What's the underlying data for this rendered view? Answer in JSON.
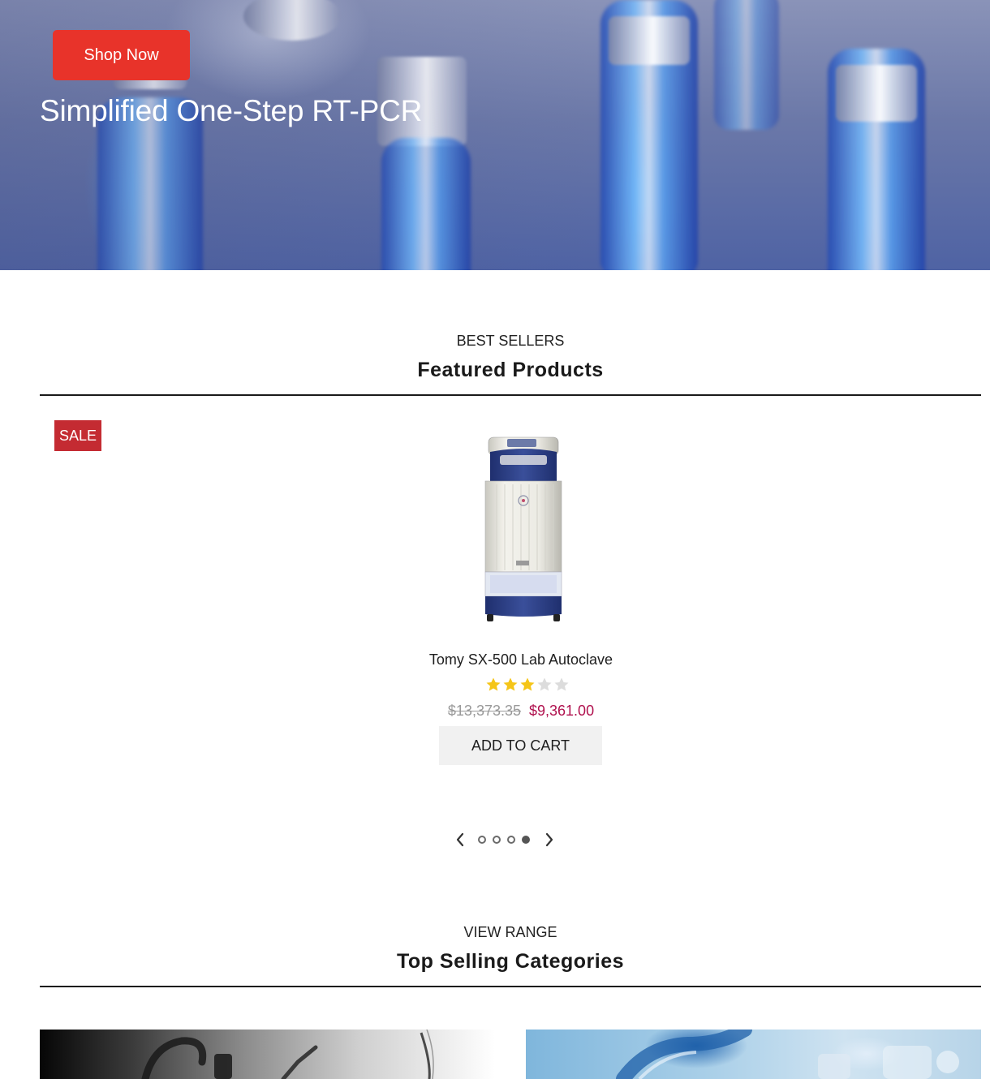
{
  "hero": {
    "button_label": "Shop Now",
    "title": "Simplified One-Step RT-PCR"
  },
  "featured": {
    "kicker": "BEST SELLERS",
    "title": "Featured Products",
    "product": {
      "badge": "SALE",
      "name": "Tomy SX-500 Lab Autoclave",
      "rating": 3,
      "rating_max": 5,
      "price_old": "$13,373.35",
      "price_new": "$9,361.00",
      "cart_label": "ADD TO CART"
    },
    "carousel": {
      "pages": 4,
      "active_page": 4
    }
  },
  "categories": {
    "kicker": "VIEW RANGE",
    "title": "Top Selling Categories"
  },
  "colors": {
    "accent_button": "#e8332a",
    "sale_badge": "#c42b32",
    "sale_price": "#b0114e",
    "star_filled": "#f5c518",
    "star_empty": "#dcdcdc"
  },
  "icons": {
    "prev": "chevron-left-icon",
    "next": "chevron-right-icon",
    "star": "star-icon"
  }
}
